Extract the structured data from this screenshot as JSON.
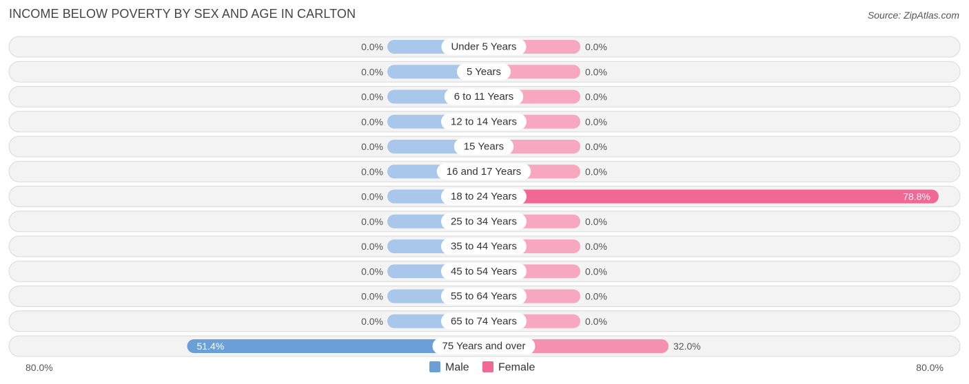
{
  "chart_data": {
    "type": "bar",
    "orientation": "horizontal-diverging",
    "title": "INCOME BELOW POVERTY BY SEX AND AGE IN CARLTON",
    "source": "Source: ZipAtlas.com",
    "categories": [
      "Under 5 Years",
      "5 Years",
      "6 to 11 Years",
      "12 to 14 Years",
      "15 Years",
      "16 and 17 Years",
      "18 to 24 Years",
      "25 to 34 Years",
      "35 to 44 Years",
      "45 to 54 Years",
      "55 to 64 Years",
      "65 to 74 Years",
      "75 Years and over"
    ],
    "series": [
      {
        "name": "Male",
        "color": "#6a9fd8",
        "zero_color": "#a9c7ea",
        "values": [
          0.0,
          0.0,
          0.0,
          0.0,
          0.0,
          0.0,
          0.0,
          0.0,
          0.0,
          0.0,
          0.0,
          0.0,
          51.4
        ],
        "labels": [
          "0.0%",
          "0.0%",
          "0.0%",
          "0.0%",
          "0.0%",
          "0.0%",
          "0.0%",
          "0.0%",
          "0.0%",
          "0.0%",
          "0.0%",
          "0.0%",
          "51.4%"
        ]
      },
      {
        "name": "Female",
        "color": "#f06893",
        "light_color": "#f590b0",
        "zero_color": "#f7a8c0",
        "values": [
          0.0,
          0.0,
          0.0,
          0.0,
          0.0,
          0.0,
          78.8,
          0.0,
          0.0,
          0.0,
          0.0,
          0.0,
          32.0
        ],
        "labels": [
          "0.0%",
          "0.0%",
          "0.0%",
          "0.0%",
          "0.0%",
          "0.0%",
          "78.8%",
          "0.0%",
          "0.0%",
          "0.0%",
          "0.0%",
          "0.0%",
          "32.0%"
        ]
      }
    ],
    "axis": {
      "min": 0,
      "max": 80,
      "left_label": "80.0%",
      "right_label": "80.0%"
    },
    "legend": {
      "position": "bottom-center",
      "items": [
        "Male",
        "Female"
      ]
    },
    "unit": "%"
  }
}
